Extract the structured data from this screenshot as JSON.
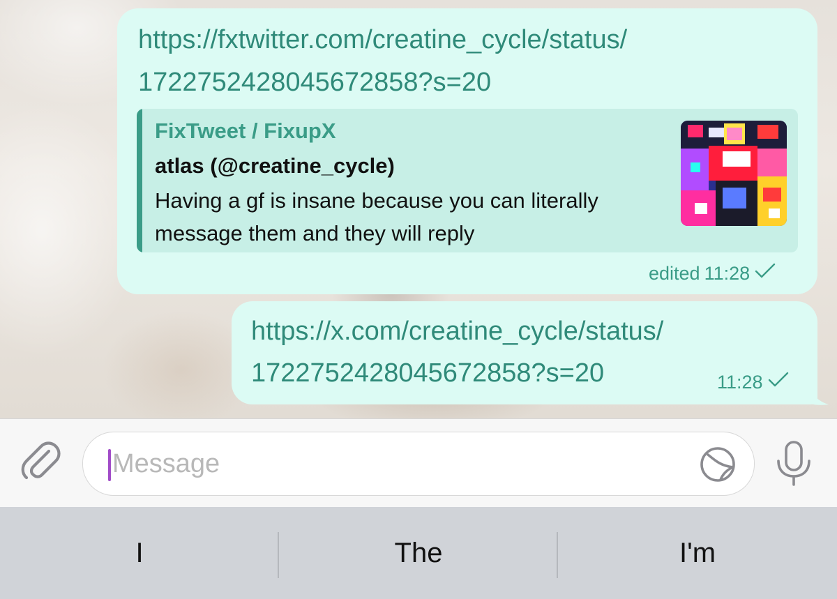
{
  "messages": [
    {
      "link_line1": "https://fxtwitter.com/creatine_cycle/status/",
      "link_line2": "1722752428045672858?s=20",
      "preview": {
        "site": "FixTweet / FixupX",
        "author": "atlas (@creatine_cycle)",
        "text": "Having a gf is insane because you can literally message them and they will reply",
        "thumbnail_icon": "tweet-image-thumbnail"
      },
      "edited_label": "edited",
      "time": "11:28",
      "status_icon": "check-icon"
    },
    {
      "link_line1": "https://x.com/creatine_cycle/status/",
      "link_line2": "1722752428045672858?s=20",
      "time": "11:28",
      "status_icon": "check-icon"
    }
  ],
  "composer": {
    "placeholder": "Message",
    "attach_icon": "paperclip-icon",
    "sticker_icon": "sticker-icon",
    "mic_icon": "microphone-icon"
  },
  "suggestions": [
    "I",
    "The",
    "I'm"
  ],
  "colors": {
    "bubble": "#dcfbf4",
    "accent": "#3a9c87",
    "link": "#2f8a79",
    "caret": "#a14cc8",
    "keyboard": "#d0d3d8"
  }
}
